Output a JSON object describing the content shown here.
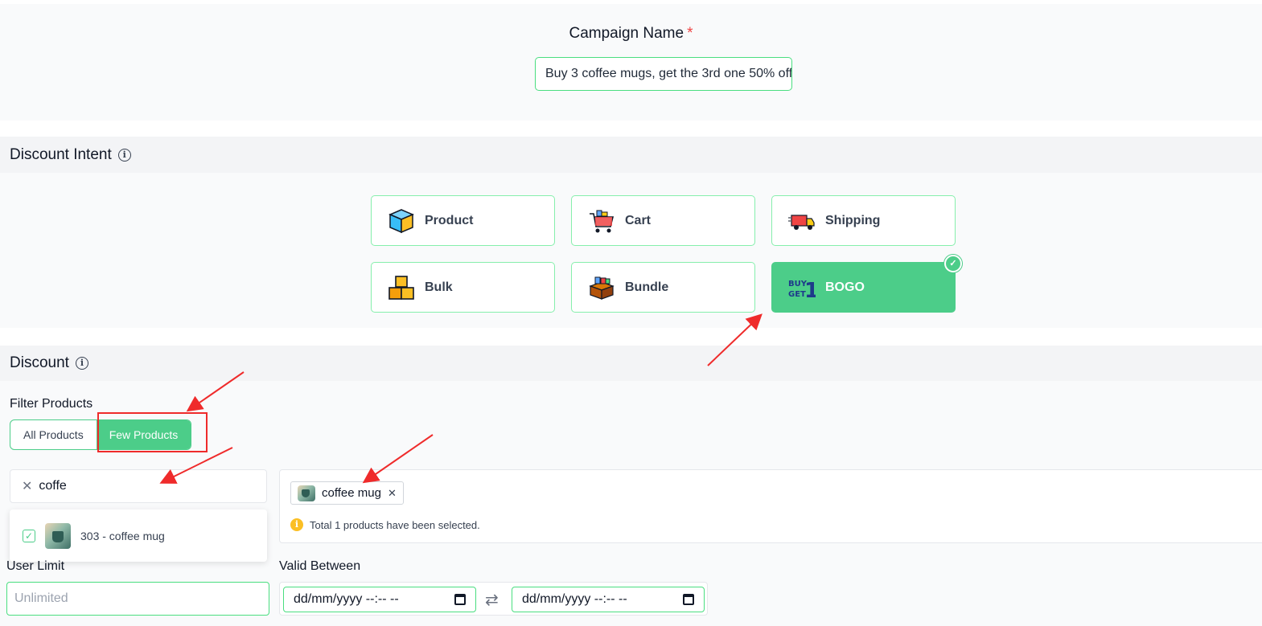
{
  "campaign": {
    "label": "Campaign Name",
    "required_mark": "*",
    "value": "Buy 3 coffee mugs, get the 3rd one 50% off"
  },
  "discount_intent": {
    "title": "Discount Intent",
    "options": [
      {
        "label": "Product",
        "icon": "box-icon",
        "selected": false
      },
      {
        "label": "Cart",
        "icon": "shopping-cart-icon",
        "selected": false
      },
      {
        "label": "Shipping",
        "icon": "delivery-truck-icon",
        "selected": false
      },
      {
        "label": "Bulk",
        "icon": "stacked-boxes-icon",
        "selected": false
      },
      {
        "label": "Bundle",
        "icon": "bundle-box-icon",
        "selected": false
      },
      {
        "label": "BOGO",
        "icon": "buy-get-one-icon",
        "selected": true
      }
    ],
    "bogo_icon_text_top": "BUY",
    "bogo_icon_text_bottom": "GET",
    "bogo_icon_number": "1",
    "check_mark": "✓"
  },
  "discount": {
    "title": "Discount",
    "filter_label": "Filter Products",
    "filter_options": [
      "All Products",
      "Few Products"
    ],
    "filter_selected": "Few Products",
    "search_value": "coffe",
    "search_clear": "✕",
    "result_item": "303 - coffee mug",
    "result_checked": "✓",
    "selected_tag": "coffee mug",
    "tag_remove": "✕",
    "selection_notice": "Total 1 products have been selected.",
    "notice_icon": "i"
  },
  "user_limit": {
    "label": "User Limit",
    "placeholder": "Unlimited"
  },
  "valid_between": {
    "label": "Valid Between",
    "start": "dd/mm/yyyy --:-- --",
    "end": "dd/mm/yyyy --:-- --",
    "swap": "⇄"
  },
  "colors": {
    "accent": "#4ccd89",
    "annotation": "#ef2b2b",
    "required": "#ef4444"
  }
}
